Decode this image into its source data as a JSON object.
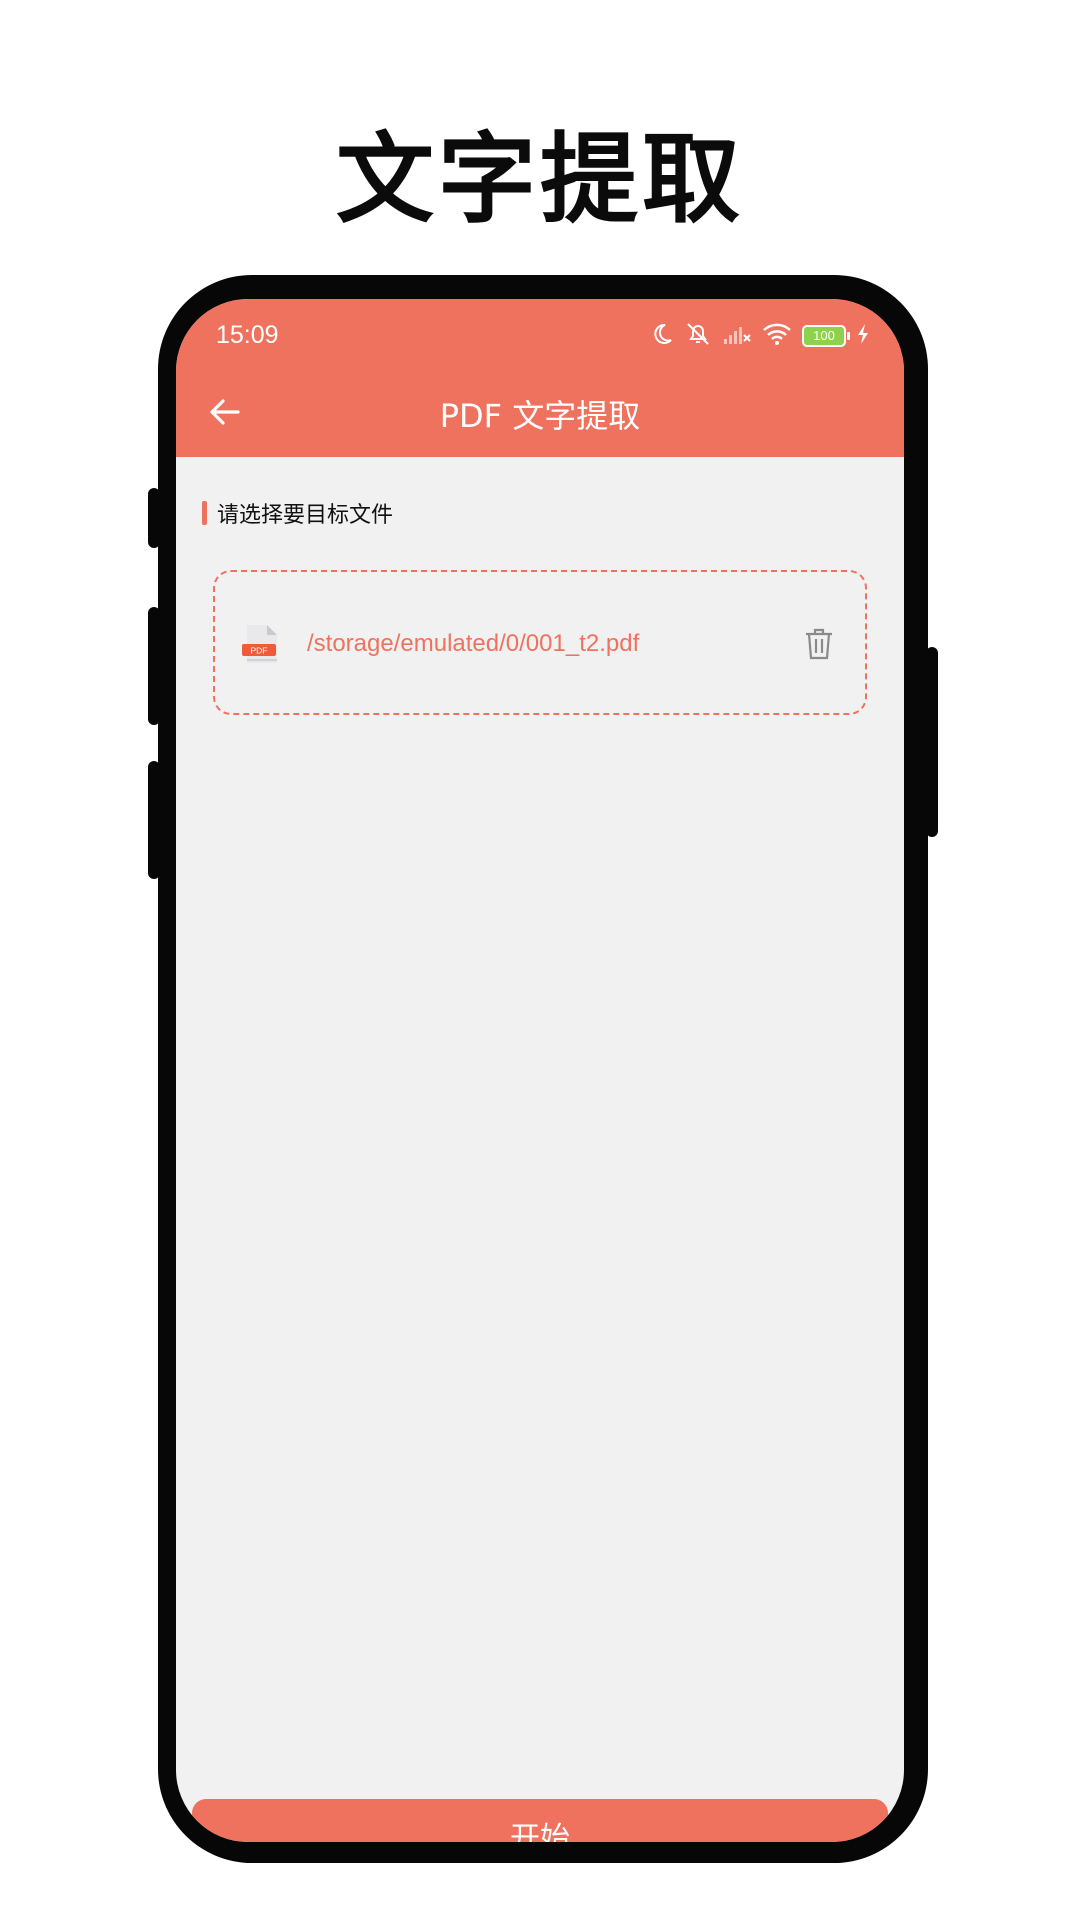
{
  "headline": "文字提取",
  "status_bar": {
    "time": "15:09",
    "battery_level": "100"
  },
  "toolbar": {
    "title": "PDF 文字提取"
  },
  "section": {
    "label": "请选择要目标文件"
  },
  "file": {
    "path": "/storage/emulated/0/001_t2.pdf",
    "icon_label": "PDF"
  },
  "actions": {
    "start_label": "开始"
  },
  "colors": {
    "accent": "#ef725f",
    "background": "#f1f1f1",
    "phone_frame": "#070707"
  }
}
